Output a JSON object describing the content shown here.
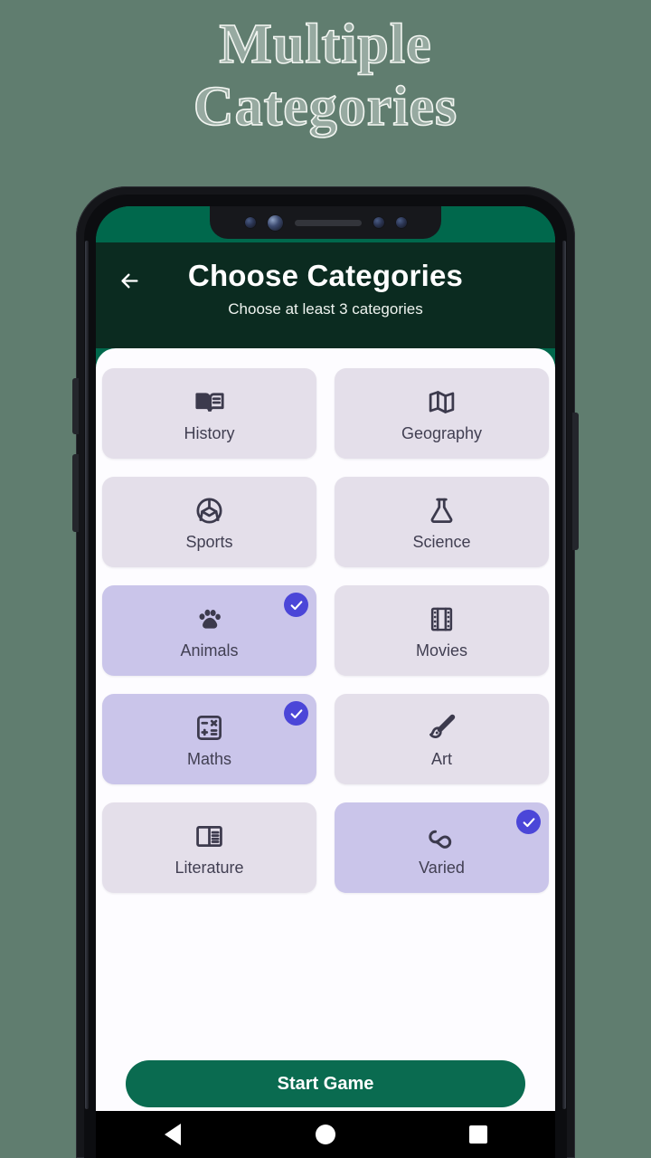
{
  "promo": {
    "line1": "Multiple",
    "line2": "Categories"
  },
  "colors": {
    "page_background": "#607d6f",
    "status_bar": "#00684c",
    "app_bar": "#0b2b20",
    "sheet": "#fdfcff",
    "card": "#e4dfea",
    "card_selected": "#cac5ea",
    "badge": "#4b46d8",
    "start_button": "#0a6b50",
    "icon": "#3c3a4d"
  },
  "app_bar": {
    "back_icon": "arrow-back-icon",
    "title": "Choose Categories",
    "subtitle": "Choose at least 3 categories"
  },
  "categories": [
    {
      "label": "History",
      "icon": "open-book-icon",
      "selected": false
    },
    {
      "label": "Geography",
      "icon": "folded-map-icon",
      "selected": false
    },
    {
      "label": "Sports",
      "icon": "sports-ball-icon",
      "selected": false
    },
    {
      "label": "Science",
      "icon": "conical-flask-icon",
      "selected": false
    },
    {
      "label": "Animals",
      "icon": "paw-print-icon",
      "selected": true
    },
    {
      "label": "Movies",
      "icon": "film-strip-icon",
      "selected": false
    },
    {
      "label": "Maths",
      "icon": "calculator-icon",
      "selected": true
    },
    {
      "label": "Art",
      "icon": "paint-brush-icon",
      "selected": false
    },
    {
      "label": "Literature",
      "icon": "reader-mode-icon",
      "selected": false
    },
    {
      "label": "Varied",
      "icon": "infinity-icon",
      "selected": true
    }
  ],
  "selected_count": 3,
  "footer": {
    "start_label": "Start Game"
  },
  "system_nav": {
    "back": "triangle-back-icon",
    "home": "circle-home-icon",
    "recents": "square-recents-icon"
  }
}
